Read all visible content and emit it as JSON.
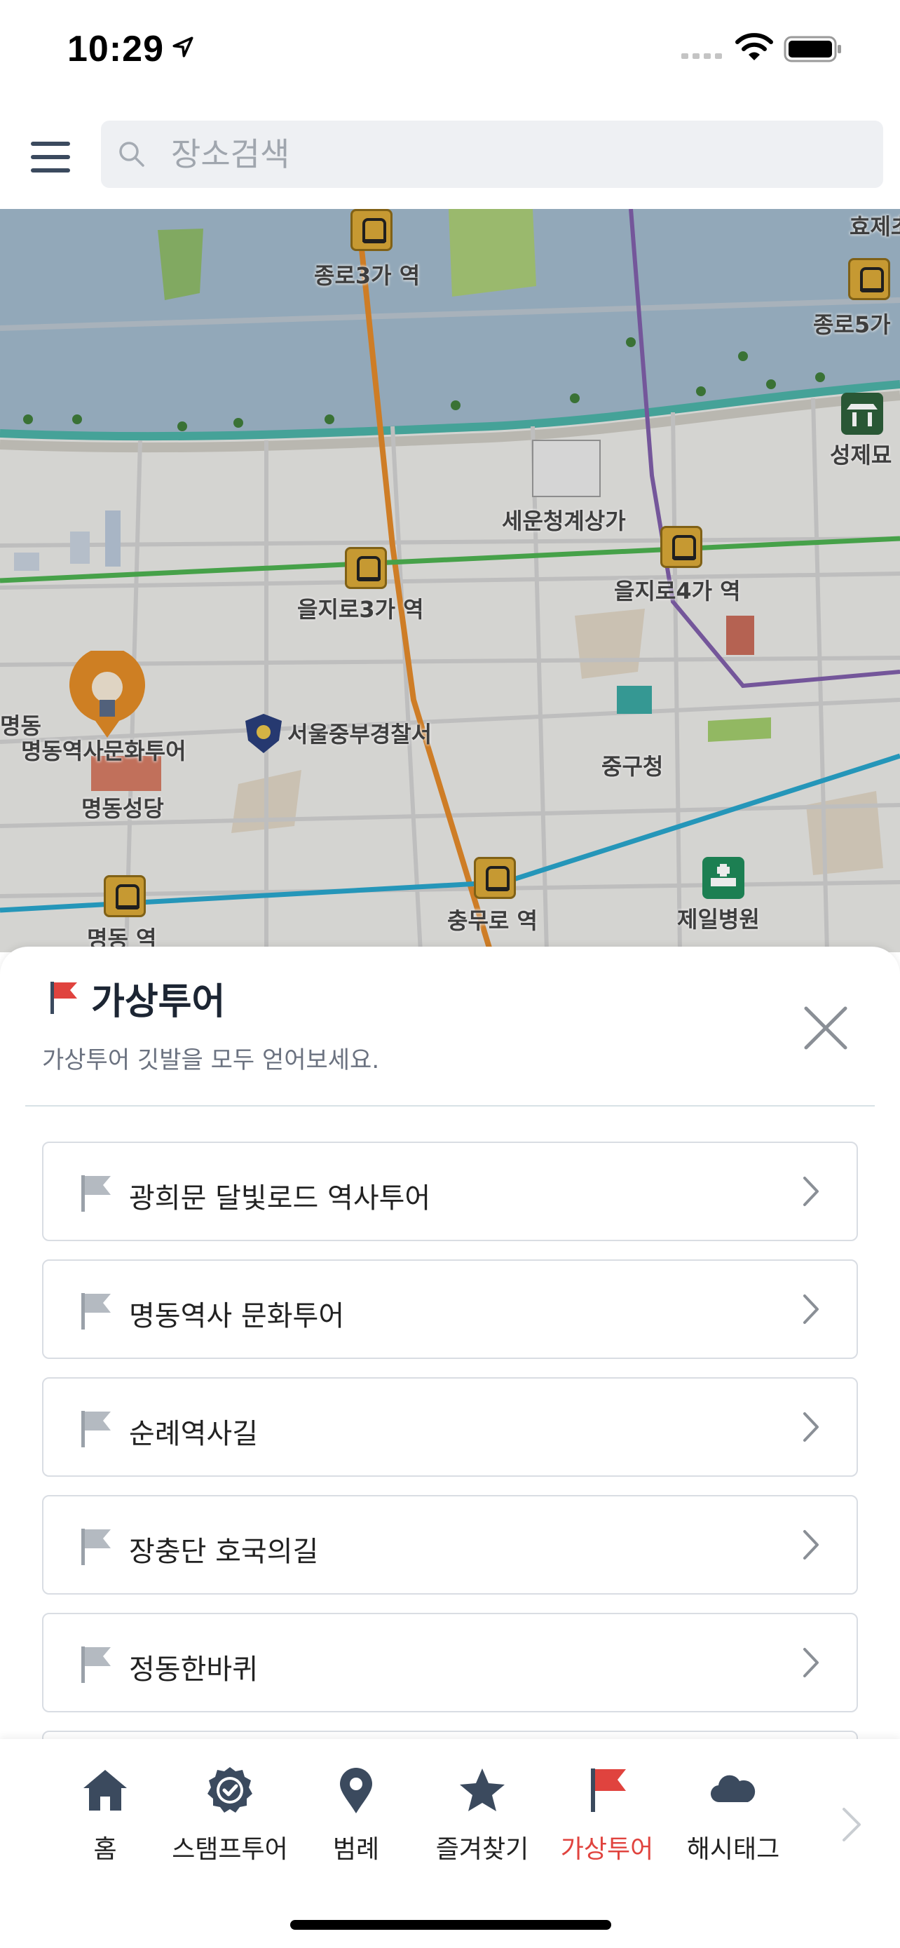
{
  "status_bar": {
    "time": "10:29",
    "location_icon": "location-arrow-icon",
    "signal_icon": "cellular-signal-icon",
    "wifi_icon": "wifi-icon",
    "battery_icon": "battery-icon"
  },
  "header": {
    "menu_icon": "hamburger-menu-icon",
    "search": {
      "placeholder": "장소검색",
      "value": "",
      "icon": "search-icon"
    }
  },
  "map": {
    "labels": {
      "jongno3": "종로3가 역",
      "hyoje": "효제초",
      "jongno5": "종로5가",
      "seongjemyo": "성제묘",
      "sewoon": "세운청계상가",
      "euljiro3": "을지로3가 역",
      "euljiro4": "을지로4가 역",
      "myeongdong": "명동",
      "myeongdong_tour": "명동역사문화투어",
      "police": "서울중부경찰서",
      "junggu": "중구청",
      "myeongdong_cathedral": "명동성당",
      "chungmuro": "충무로 역",
      "jeil_hospital": "제일병원",
      "myeongdong_station": "명동 역"
    }
  },
  "sheet": {
    "title": "가상투어",
    "subtitle": "가상투어 깃발을 모두 얻어보세요.",
    "flag_color": "#e0433e",
    "close_icon": "close-icon",
    "tours": [
      {
        "label": "광희문 달빛로드 역사투어"
      },
      {
        "label": "명동역사 문화투어"
      },
      {
        "label": "순례역사길"
      },
      {
        "label": "장충단 호국의길"
      },
      {
        "label": "정동한바퀴"
      }
    ]
  },
  "tab_bar": {
    "active_color": "#e0433e",
    "icon_color": "#3b4a5e",
    "tabs": [
      {
        "label": "홈",
        "icon": "home-icon",
        "active": false
      },
      {
        "label": "스탬프투어",
        "icon": "stamp-badge-icon",
        "active": false
      },
      {
        "label": "범례",
        "icon": "map-pin-icon",
        "active": false
      },
      {
        "label": "즐겨찾기",
        "icon": "star-icon",
        "active": false
      },
      {
        "label": "가상투어",
        "icon": "flag-icon",
        "active": true
      },
      {
        "label": "해시태그",
        "icon": "cloud-icon",
        "active": false
      }
    ],
    "more_icon": "chevron-right-icon"
  }
}
